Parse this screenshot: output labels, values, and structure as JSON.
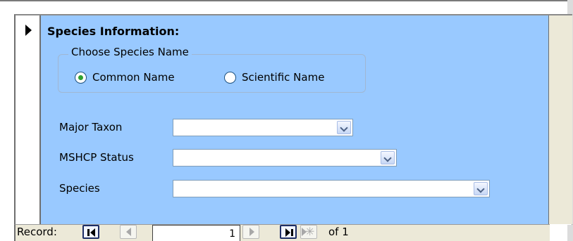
{
  "form": {
    "section_title": "Species Information:",
    "group_label": "Choose Species Name",
    "radios": [
      {
        "label": "Common Name",
        "selected": true
      },
      {
        "label": "Scientific Name",
        "selected": false
      }
    ],
    "fields": [
      {
        "label": "Major Taxon",
        "value": ""
      },
      {
        "label": "MSHCP Status",
        "value": ""
      },
      {
        "label": "Species",
        "value": ""
      }
    ]
  },
  "navigation": {
    "label": "Record:",
    "current_record": "1",
    "of_text": "of",
    "total_records": "1"
  },
  "colors": {
    "detail_background": "#99c9ff",
    "radio_selected": "#2fa12f",
    "nav_background": "#ece9d8"
  }
}
